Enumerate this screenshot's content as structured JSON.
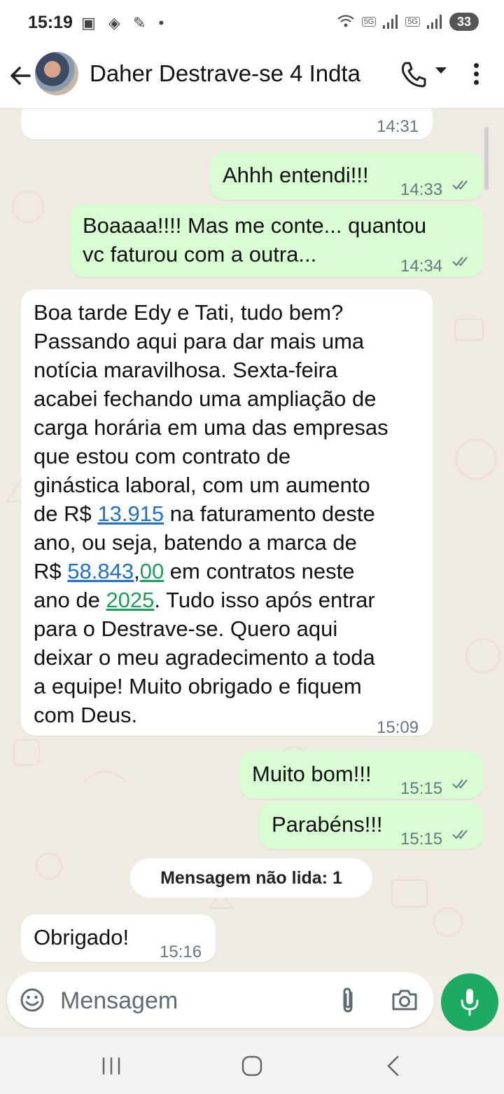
{
  "status_bar": {
    "time": "15:19",
    "left_icons": "▣ ◈ ✎ •",
    "network_a": "5G",
    "network_b": "5G",
    "battery": "33"
  },
  "header": {
    "contact_name": "Daher Destrave-se 4 Indta"
  },
  "messages": [
    {
      "time": "14:31"
    },
    {
      "text": "Ahhh entendi!!!",
      "time": "14:33"
    },
    {
      "text_line1": "Boaaaa!!!! Mas me conte... quantou",
      "text_line2": "vc faturou com a outra...",
      "time": "14:34"
    },
    {
      "lines": [
        "Boa tarde Edy e Tati, tudo bem?",
        "Passando aqui para dar mais uma",
        "notícia maravilhosa. Sexta-feira",
        "acabei fechando uma ampliação de",
        "carga horária em uma das empresas",
        "que estou com contrato de",
        "ginástica laboral, com um aumento"
      ],
      "l8_a": "de R$ ",
      "l8_link": "13.915",
      "l8_b": " na faturamento deste",
      "l9": "ano, ou seja, batendo a marca de",
      "l10_a": "R$ ",
      "l10_link1": "58.843",
      "l10_comma": ",",
      "l10_link2": "00",
      "l10_b": " em contratos neste",
      "l11_a": "ano de ",
      "l11_link": "2025",
      "l11_b": ". Tudo isso após entrar",
      "l12": "para o Destrave-se. Quero aqui",
      "l13": "deixar o meu agradecimento a toda",
      "l14": "a equipe! Muito obrigado e fiquem",
      "l15": "com Deus.",
      "time": "15:09"
    },
    {
      "text": "Muito bom!!!",
      "time": "15:15"
    },
    {
      "text": "Parabéns!!!",
      "time": "15:15"
    },
    {
      "text": "Obrigado!",
      "time": "15:16"
    }
  ],
  "unread_label": "Mensagem não lida: 1",
  "composer": {
    "placeholder": "Mensagem"
  },
  "colors": {
    "outgoing": "#d9fdd3",
    "incoming": "#ffffff",
    "mic": "#1daa61",
    "link": "#1f6fd1",
    "number_link": "#1e9e5a"
  }
}
